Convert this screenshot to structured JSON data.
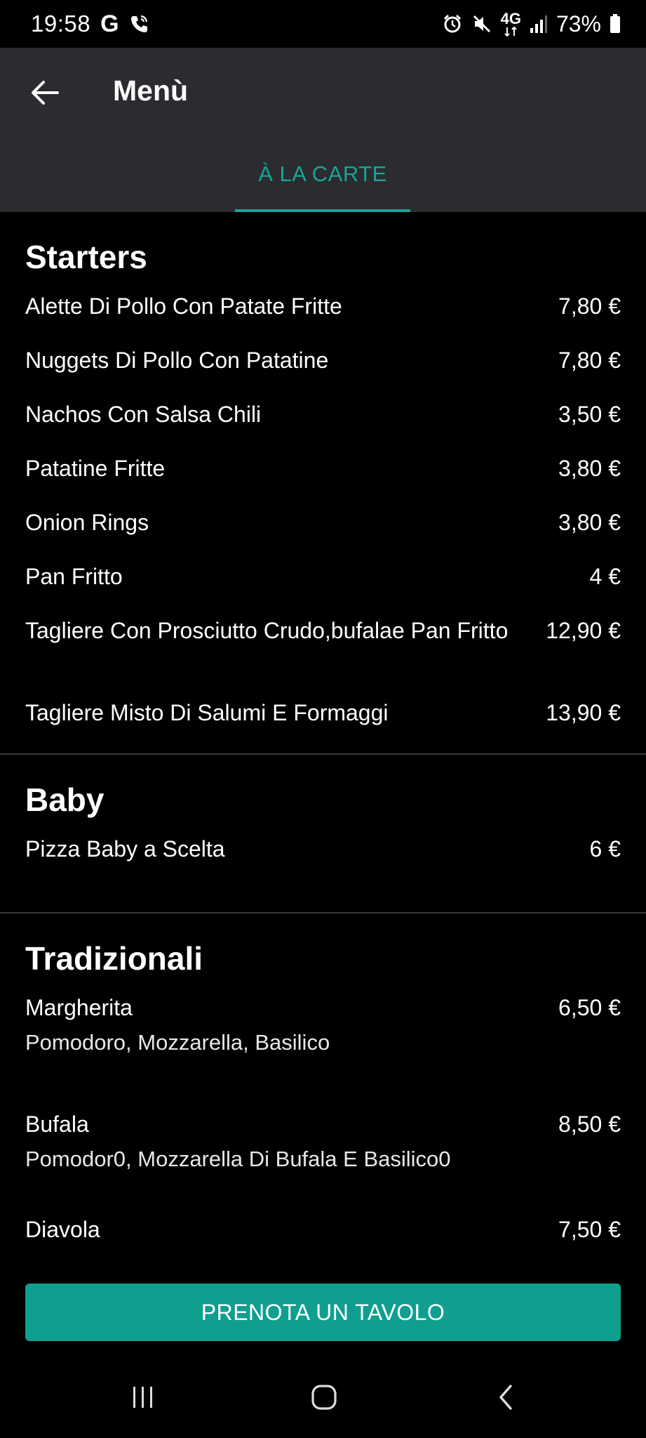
{
  "status_bar": {
    "time": "19:58",
    "left_icons": [
      "google-g-icon",
      "wifi-calling-icon"
    ],
    "g_letter": "G",
    "battery": "73%",
    "network": "4G",
    "right_icons": [
      "alarm-icon",
      "mute-icon",
      "network-4g-icon",
      "signal-icon",
      "battery-icon"
    ]
  },
  "app_bar": {
    "title": "Menù",
    "back_icon": "arrow-left-icon",
    "tabs": [
      {
        "label": "À LA CARTE",
        "active": true
      }
    ]
  },
  "menu": {
    "sections": [
      {
        "title": "Starters",
        "items": [
          {
            "name": "Alette Di Pollo Con Patate Fritte",
            "price": "7,80 €"
          },
          {
            "name": "Nuggets Di Pollo Con Patatine",
            "price": "7,80 €"
          },
          {
            "name": "Nachos Con Salsa Chili",
            "price": "3,50 €"
          },
          {
            "name": "Patatine Fritte",
            "price": "3,80 €"
          },
          {
            "name": "Onion Rings",
            "price": "3,80 €"
          },
          {
            "name": "Pan Fritto",
            "price": "4 €"
          },
          {
            "name": "Tagliere Con Prosciutto Crudo,bufalae Pan Fritto",
            "price": "12,90 €"
          },
          {
            "name": "Tagliere Misto Di Salumi E Formaggi",
            "price": "13,90 €"
          }
        ]
      },
      {
        "title": "Baby",
        "items": [
          {
            "name": "Pizza Baby a Scelta",
            "price": "6 €"
          }
        ]
      },
      {
        "title": "Tradizionali",
        "items": [
          {
            "name": "Margherita",
            "price": "6,50 €",
            "description": "Pomodoro, Mozzarella, Basilico"
          },
          {
            "name": "Bufala",
            "price": "8,50 €",
            "description": "Pomodor0, Mozzarella Di Bufala E Basilico0"
          },
          {
            "name": "Diavola",
            "price": "7,50 €"
          }
        ]
      }
    ]
  },
  "cta": {
    "label": "PRENOTA UN TAVOLO"
  },
  "nav_bar": {
    "icons": [
      "recent-apps-icon",
      "home-icon",
      "back-chevron-icon"
    ]
  },
  "colors": {
    "accent": "#1aa396",
    "cta": "#0f9f8f",
    "app_bar": "#2a2c30",
    "background": "#000000"
  }
}
